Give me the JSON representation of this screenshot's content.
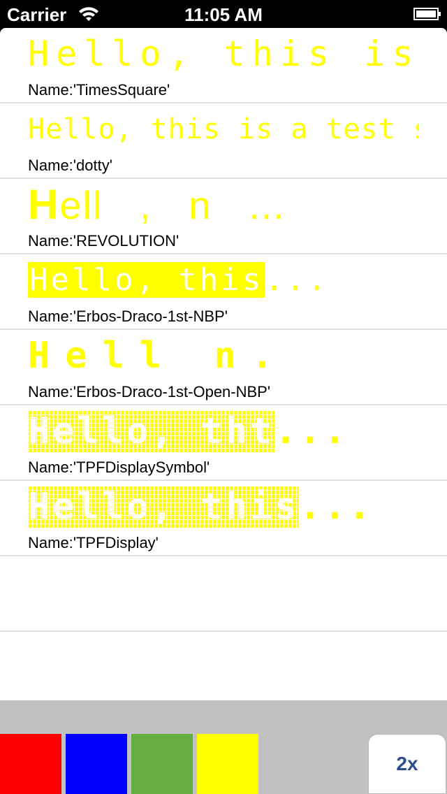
{
  "status_bar": {
    "carrier": "Carrier",
    "time": "11:05 AM"
  },
  "rows": [
    {
      "sample": "Hello, this is a...",
      "label": "Name:'TimesSquare'"
    },
    {
      "sample": "Hello, this is a test string",
      "label": "Name:'dotty'"
    },
    {
      "sample_h": "H",
      "sample_rest": "ell   ,   n   ...",
      "label": "Name:'REVOLUTION'"
    },
    {
      "sample_hl": "Hello, this",
      "sample_rest": "...",
      "label": "Name:'Erbos-Draco-1st-NBP'"
    },
    {
      "sample": "Hell n.",
      "label": "Name:'Erbos-Draco-1st-Open-NBP'"
    },
    {
      "sample_hl": "Hello, tht",
      "sample_rest": "...",
      "label": "Name:'TPFDisplaySymbol'"
    },
    {
      "sample_hl": "Hello, this",
      "sample_rest": "...",
      "label": "Name:'TPFDisplay'"
    }
  ],
  "toolbar": {
    "colors": [
      "#ff0000",
      "#0000ff",
      "#66ad44",
      "#ffff00"
    ],
    "zoom_label": "2x"
  },
  "colors": {
    "sample_text": "#ffff00",
    "separator": "#dedede",
    "toolbar_bg": "#c1c1c1",
    "button_text": "#2c4c8c"
  }
}
